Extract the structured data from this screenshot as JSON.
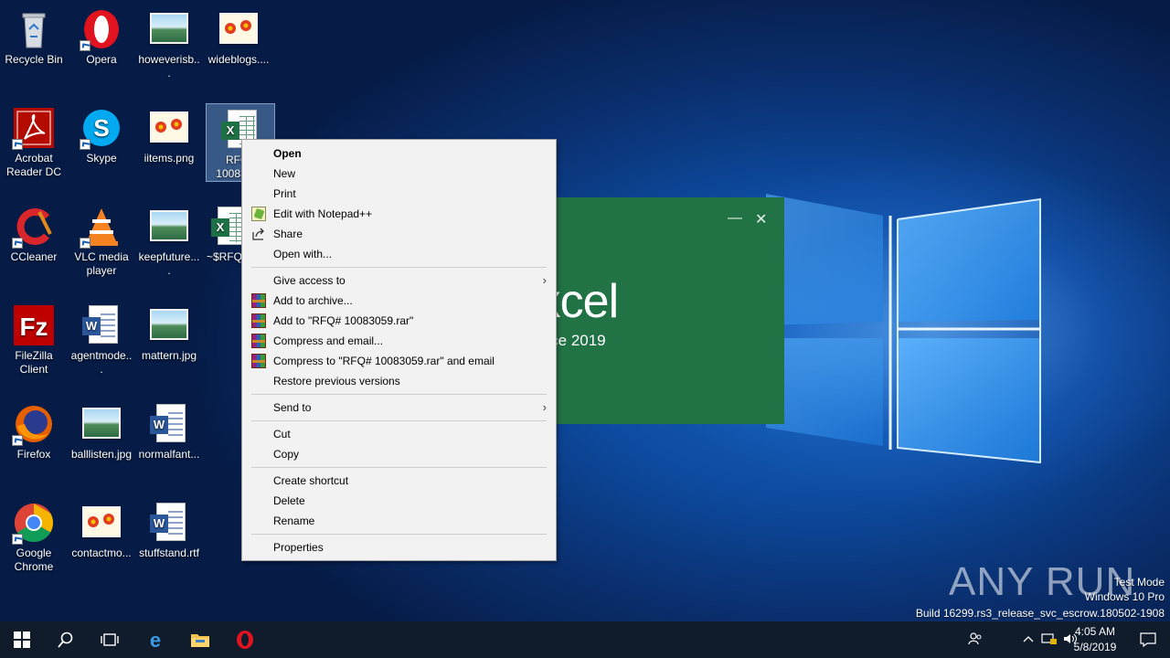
{
  "desktop": {
    "icons": [
      {
        "label": "Recycle Bin",
        "icon": "recycle-bin-icon"
      },
      {
        "label": "Opera",
        "icon": "opera-icon"
      },
      {
        "label": "howeverisb...",
        "icon": "image-file-icon"
      },
      {
        "label": "wideblogs....",
        "icon": "image-file-icon"
      },
      {
        "label": "Acrobat Reader DC",
        "icon": "acrobat-icon"
      },
      {
        "label": "Skype",
        "icon": "skype-icon"
      },
      {
        "label": "iitems.png",
        "icon": "image-file-icon"
      },
      {
        "label": "RFQ# 10083059",
        "icon": "excel-file-icon"
      },
      {
        "label": "CCleaner",
        "icon": "ccleaner-icon"
      },
      {
        "label": "VLC media player",
        "icon": "vlc-icon"
      },
      {
        "label": "keepfuture....",
        "icon": "image-file-icon"
      },
      {
        "label": "~$RFQ# 10083059",
        "icon": "excel-file-icon"
      },
      {
        "label": "FileZilla Client",
        "icon": "filezilla-icon"
      },
      {
        "label": "agentmode...",
        "icon": "word-file-icon"
      },
      {
        "label": "mattern.jpg",
        "icon": "image-file-icon"
      },
      {
        "label": "Firefox",
        "icon": "firefox-icon"
      },
      {
        "label": "balllisten.jpg",
        "icon": "image-file-icon"
      },
      {
        "label": "normalfant...",
        "icon": "word-file-icon"
      },
      {
        "label": "Google Chrome",
        "icon": "chrome-icon"
      },
      {
        "label": "contactmo...",
        "icon": "image-file-icon"
      },
      {
        "label": "stuffstand.rtf",
        "icon": "word-file-icon"
      }
    ]
  },
  "excel_splash": {
    "title": "Excel",
    "subtitle": "Office 2019",
    "minimize": "—",
    "close": "✕"
  },
  "context_menu": {
    "items": [
      {
        "label": "Open",
        "bold": true
      },
      {
        "label": "New"
      },
      {
        "label": "Print"
      },
      {
        "label": "Edit with Notepad++",
        "icon": "notepadpp-icon"
      },
      {
        "label": "Share",
        "icon": "share-icon"
      },
      {
        "label": "Open with..."
      },
      {
        "label": "Give access to",
        "submenu": true
      },
      {
        "label": "Add to archive...",
        "icon": "winrar-icon"
      },
      {
        "label": "Add to \"RFQ# 10083059.rar\"",
        "icon": "winrar-icon"
      },
      {
        "label": "Compress and email...",
        "icon": "winrar-icon"
      },
      {
        "label": "Compress to \"RFQ# 10083059.rar\" and email",
        "icon": "winrar-icon"
      },
      {
        "label": "Restore previous versions"
      },
      {
        "label": "Send to",
        "submenu": true
      },
      {
        "label": "Cut"
      },
      {
        "label": "Copy"
      },
      {
        "label": "Create shortcut"
      },
      {
        "label": "Delete"
      },
      {
        "label": "Rename"
      },
      {
        "label": "Properties"
      }
    ],
    "submenu_arrow": "›"
  },
  "watermark": {
    "logo": "ANY RUN",
    "line1": "Test Mode",
    "line2": "Windows 10 Pro",
    "line3": "Build 16299.rs3_release_svc_escrow.180502-1908"
  },
  "taskbar": {
    "time": "4:05 AM",
    "date": "5/8/2019"
  },
  "colors": {
    "excel_green": "#217346",
    "taskbar": "#101b2b",
    "menu_bg": "#f2f2f2"
  }
}
